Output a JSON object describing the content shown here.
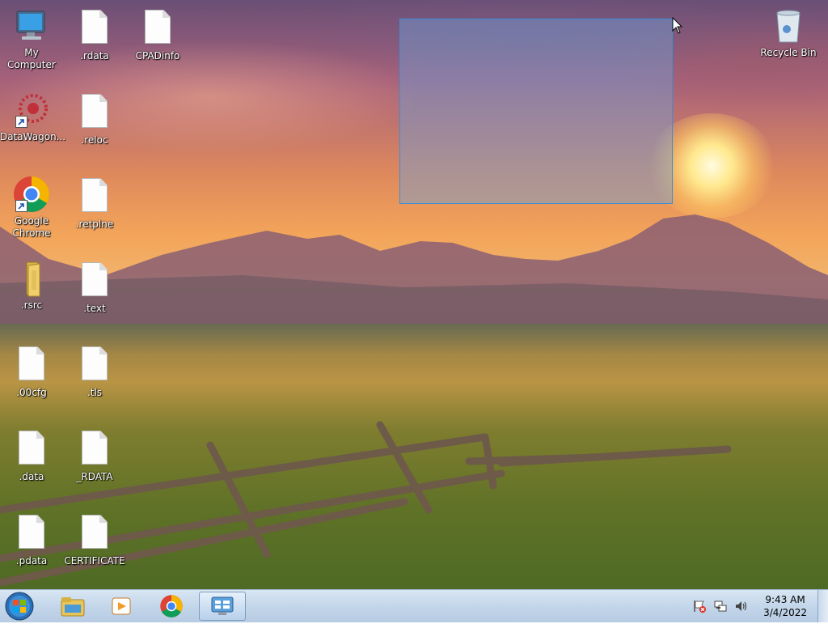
{
  "desktop": {
    "icons_left": [
      {
        "label": "My Computer",
        "icon": "computer-icon"
      },
      {
        "label": "DataWagon...",
        "icon": "datawagon-icon"
      },
      {
        "label": "Google Chrome",
        "icon": "chrome-icon"
      },
      {
        "label": ".rsrc",
        "icon": "folder-icon"
      },
      {
        "label": ".00cfg",
        "icon": "file-icon"
      },
      {
        "label": ".data",
        "icon": "file-icon"
      },
      {
        "label": ".pdata",
        "icon": "file-icon"
      }
    ],
    "icons_mid": [
      {
        "label": ".rdata",
        "icon": "file-icon"
      },
      {
        "label": ".reloc",
        "icon": "file-icon"
      },
      {
        "label": ".retplne",
        "icon": "file-icon"
      },
      {
        "label": ".text",
        "icon": "file-icon"
      },
      {
        "label": ".tls",
        "icon": "file-icon"
      },
      {
        "label": "_RDATA",
        "icon": "file-icon"
      },
      {
        "label": "CERTIFICATE",
        "icon": "file-icon"
      }
    ],
    "icon_cpadinfo": {
      "label": "CPADinfo",
      "icon": "file-icon"
    },
    "icon_recycle": {
      "label": "Recycle Bin",
      "icon": "recycle-bin-icon"
    }
  },
  "taskbar": {
    "start": "start-orb-icon",
    "pinned": [
      "windows-explorer-icon",
      "media-player-icon",
      "chrome-icon",
      "control-panel-icon"
    ],
    "tray_icons": [
      "action-center-flag-icon",
      "network-icon",
      "volume-icon"
    ],
    "clock_time": "9:43 AM",
    "clock_date": "3/4/2022"
  },
  "colors": {
    "selection_border": "#3a8fd8",
    "taskbar_bg": "#c3d6ea"
  }
}
